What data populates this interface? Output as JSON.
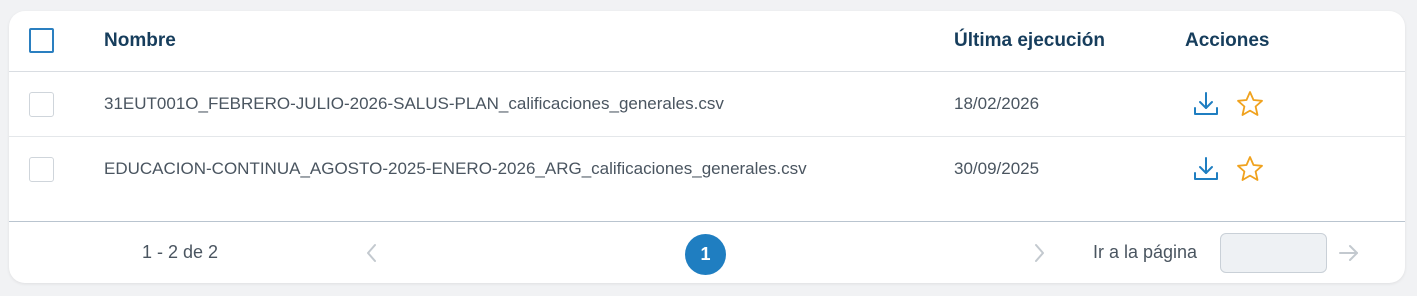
{
  "table": {
    "columns": {
      "name": "Nombre",
      "last_run": "Última ejecución",
      "actions": "Acciones"
    },
    "rows": [
      {
        "name": "31EUT001O_FEBRERO-JULIO-2026-SALUS-PLAN_calificaciones_generales.csv",
        "last_run": "18/02/2026",
        "selected": false
      },
      {
        "name": "EDUCACION-CONTINUA_AGOSTO-2025-ENERO-2026_ARG_calificaciones_generales.csv",
        "last_run": "30/09/2025",
        "selected": false
      }
    ],
    "action_icons": [
      "download-icon",
      "star-icon"
    ]
  },
  "pagination": {
    "range_text": "1 - 2 de 2",
    "current_page": "1",
    "goto_label": "Ir a la página",
    "goto_value": ""
  },
  "colors": {
    "header_text": "#163d5c",
    "accent_blue": "#1f7ec1",
    "star_orange": "#f0a21e"
  }
}
